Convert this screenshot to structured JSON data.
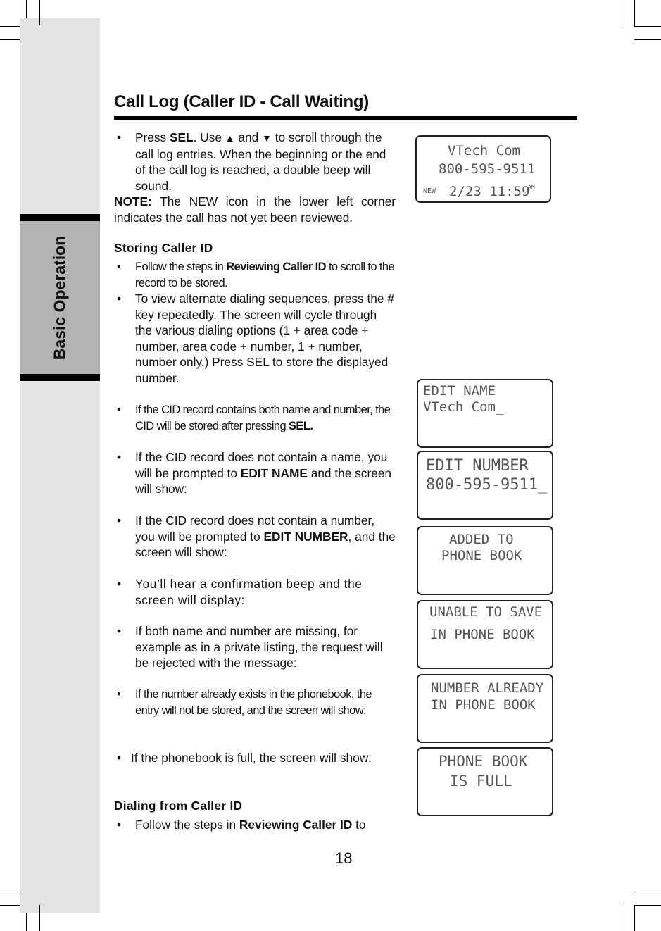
{
  "page": {
    "title": "Call Log (Caller ID - Call Waiting)",
    "section_tab": "Basic Operation",
    "page_number": "18"
  },
  "intro": {
    "bullet1": {
      "pre": "Press ",
      "sel": "SEL",
      "mid1": ". Use ",
      "up": "▲",
      "mid2": " and ",
      "down": "▼",
      "post": " to scroll through the call log entries. When the beginning or the end of the call log is reached, a double beep will sound."
    },
    "note_label": "NOTE:",
    "note_text": " The NEW icon in the lower left corner indicates the call has not yet been reviewed."
  },
  "storing": {
    "heading": "Storing Caller ID",
    "b1_pre": "Follow the steps in ",
    "b1_bold": "Reviewing Caller ID",
    "b1_post": " to scroll to the record to be stored.",
    "b2": "To view alternate dialing sequences, press the # key repeatedly. The screen will cycle through the various dialing options (1 + area code + number, area code + number, 1 + number, number only.) Press SEL to store the displayed number.",
    "b3_pre": "If the CID record contains both name and number, the CID will be stored after pressing ",
    "b3_bold": "SEL.",
    "b4_pre": "If the CID record does not contain a name, you will be prompted to ",
    "b4_bold": "EDIT NAME",
    "b4_post": " and the screen will show:",
    "b5_pre": "If the CID record does not contain a number, you will be prompted to ",
    "b5_bold": "EDIT NUMBER",
    "b5_post": ", and the screen will show:",
    "b6": "You’ll hear a confirmation beep and the screen will display:",
    "b7": "If both name and number are missing, for example as in a private listing, the request will be rejected with the message:",
    "b8": "If the number already exists in the phonebook, the entry will not be stored, and the screen will show:",
    "b9": "If the phonebook is full, the screen will show:"
  },
  "dialing": {
    "heading": "Dialing from Caller ID",
    "b1_pre": "Follow the steps in ",
    "b1_bold": "Reviewing Caller ID",
    "b1_post": " to"
  },
  "bullet_glyph": "•",
  "screens": {
    "call_entry": {
      "name": "VTech Com",
      "number": "800-595-9511",
      "new_flag": "NEW",
      "datetime": "2/23 11:59",
      "ampm": "AM"
    },
    "edit_name": {
      "line1": "EDIT NAME",
      "line2": "VTech Com_"
    },
    "edit_number": {
      "line1": "EDIT NUMBER",
      "line2": "800-595-9511_"
    },
    "added": {
      "line1": "ADDED TO",
      "line2": "PHONE BOOK"
    },
    "unable": {
      "line1": "UNABLE TO SAVE",
      "line2": "IN PHONE BOOK"
    },
    "already": {
      "line1": "NUMBER ALREADY",
      "line2": "IN PHONE BOOK"
    },
    "full": {
      "line1": "PHONE BOOK",
      "line2": "IS FULL"
    }
  }
}
